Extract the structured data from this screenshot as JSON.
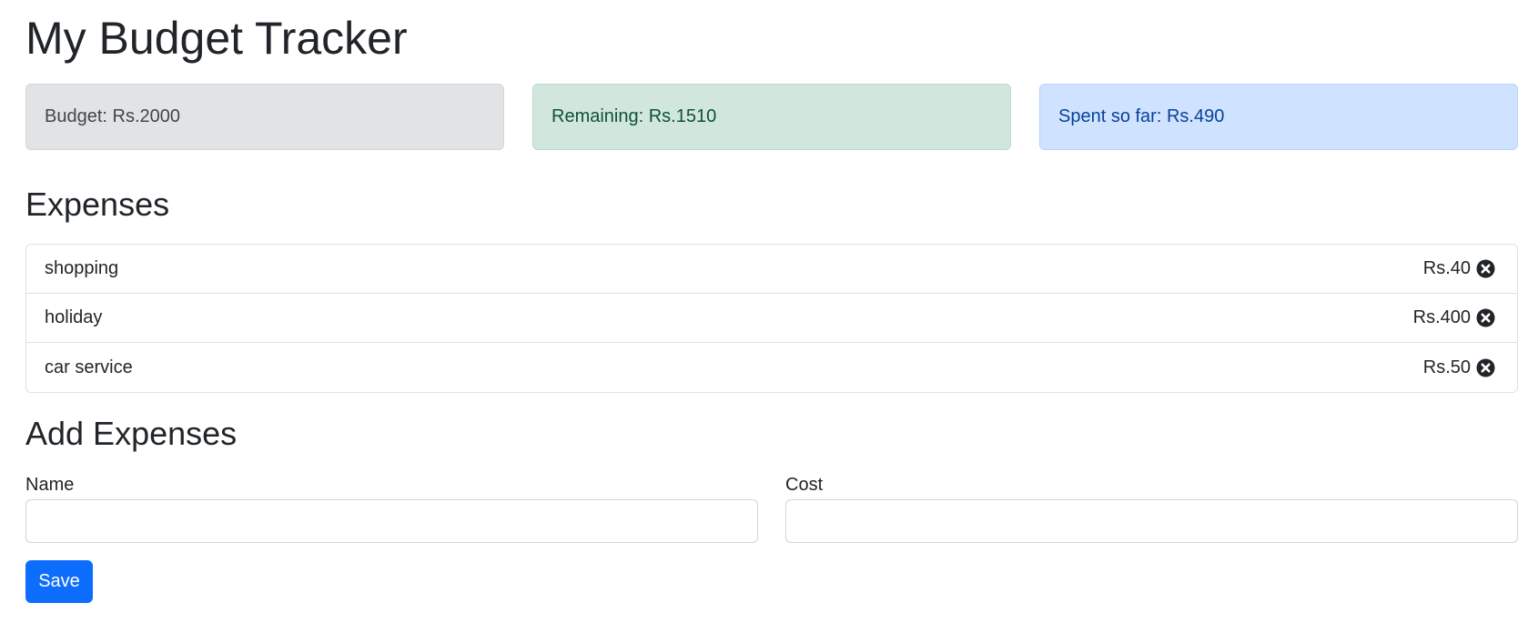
{
  "title": "My Budget Tracker",
  "summary": {
    "budget": "Budget: Rs.2000",
    "remaining": "Remaining: Rs.1510",
    "spent": "Spent so far: Rs.490"
  },
  "expenses_heading": "Expenses",
  "expenses": [
    {
      "name": "shopping",
      "cost": "Rs.40"
    },
    {
      "name": "holiday",
      "cost": "Rs.400"
    },
    {
      "name": "car service",
      "cost": "Rs.50"
    }
  ],
  "add_heading": "Add Expenses",
  "form": {
    "name_label": "Name",
    "name_value": "",
    "cost_label": "Cost",
    "cost_value": "",
    "save_label": "Save"
  },
  "icons": {
    "delete": "close-circle-icon"
  },
  "colors": {
    "budget_bg": "#e2e3e5",
    "remaining_bg": "#d1e7dd",
    "spent_bg": "#cfe2ff",
    "primary": "#0d6efd"
  }
}
